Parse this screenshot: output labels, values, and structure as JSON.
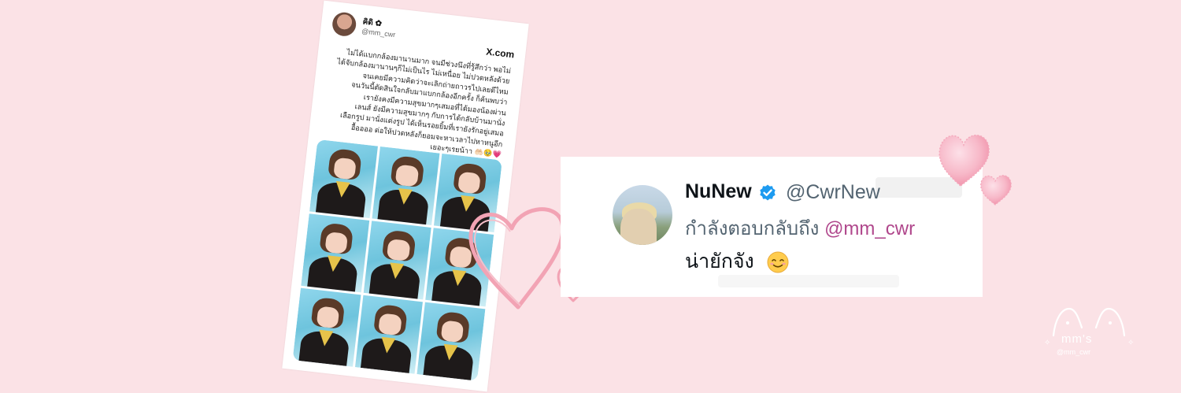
{
  "tweet": {
    "display_name": "คิดิ ✿",
    "handle": "@mm_cwr",
    "platform_logo": "X.com",
    "body": "ไม่ได้แบกกล้องมานานมาก จนมีช่วงนึงที่รู้สึกว่า พอไม่\nได้จับกล้องมานานๆก็ไม่เป็นไร ไม่เหนื่อย ไม่ปวดหลังด้วย\nจนเคยมีความคิดว่าจะเลิกถ่ายถาวรไปเลยดีไหม\nจนวันนี้ตัดสินใจกลับมาแบกกล้องอีกครั้ง ก็ค้นพบว่า\nเรายังคงมีความสุขมากๆเสมอที่ได้มองน้องผ่าน\nเลนส์ ยังมีความสุขมากๆ กับการได้กลับบ้านมานั่ง\nเลือกรูป มานั่งแต่งรูป ได้เห็นรอยยิ้มที่เรายังรักอยู่เสมอ\nอื้ออออ ต่อให้ปวดหลังก็ยอมจะหาเวลาไปหาหนูอีก\nเยอะๆเรยน้าา 🤲🏻🥹💗",
    "photo_count": 9
  },
  "reply": {
    "display_name": "NuNew",
    "verified_icon": "verified-badge-icon",
    "handle": "@CwrNew",
    "replying_to_prefix": "กำลังตอบกลับถึง",
    "replying_to_handle": "@mm_cwr",
    "text": "น่ายักจัง",
    "emoji_icon": "smiling-face-icon"
  },
  "watermark": {
    "line1": "mm's",
    "line2": "@mm_cwr"
  },
  "colors": {
    "background": "#fbe2e6",
    "heart_outline": "#f2a3b4",
    "fluffy_heart": "#f7b8c8",
    "verified_blue": "#1d9bf0",
    "mention": "#b0478c"
  }
}
